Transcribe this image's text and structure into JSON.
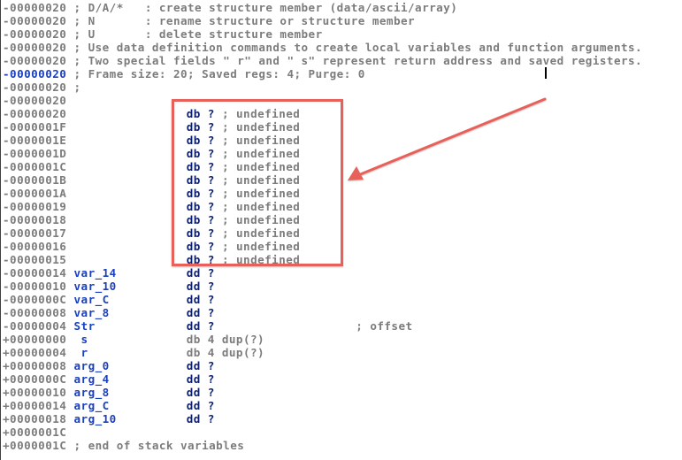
{
  "annotation": {
    "color": "#e8605a"
  },
  "colors": {
    "address": "#7c7c7c",
    "current_address": "#1a3fbf",
    "name": "#1a3fbf",
    "keyword": "#0c1f6e",
    "comment": "#7c7c7c"
  },
  "lines": [
    {
      "addr": "-00000020",
      "name": "",
      "text": "; D/A/*   : create structure member (data/ascii/array)",
      "kind": "comment"
    },
    {
      "addr": "-00000020",
      "name": "",
      "text": "; N       : rename structure or structure member",
      "kind": "comment"
    },
    {
      "addr": "-00000020",
      "name": "",
      "text": "; U       : delete structure member",
      "kind": "comment"
    },
    {
      "addr": "-00000020",
      "name": "",
      "text": "; Use data definition commands to create local variables and function arguments.",
      "kind": "comment"
    },
    {
      "addr": "-00000020",
      "name": "",
      "text": "; Two special fields \" r\" and \" s\" represent return address and saved registers.",
      "kind": "comment"
    },
    {
      "addr": "-00000020",
      "name": "",
      "text": "; Frame size: 20; Saved regs: 4; Purge: 0",
      "kind": "comment",
      "current": true
    },
    {
      "addr": "-00000020",
      "name": "",
      "text": ";",
      "kind": "comment"
    },
    {
      "addr": "-00000020",
      "name": "",
      "text": "",
      "kind": "blank"
    },
    {
      "addr": "-00000020",
      "name": "",
      "kw": "db ?",
      "comment": "; undefined",
      "kind": "undef"
    },
    {
      "addr": "-0000001F",
      "name": "",
      "kw": "db ?",
      "comment": "; undefined",
      "kind": "undef"
    },
    {
      "addr": "-0000001E",
      "name": "",
      "kw": "db ?",
      "comment": "; undefined",
      "kind": "undef"
    },
    {
      "addr": "-0000001D",
      "name": "",
      "kw": "db ?",
      "comment": "; undefined",
      "kind": "undef"
    },
    {
      "addr": "-0000001C",
      "name": "",
      "kw": "db ?",
      "comment": "; undefined",
      "kind": "undef"
    },
    {
      "addr": "-0000001B",
      "name": "",
      "kw": "db ?",
      "comment": "; undefined",
      "kind": "undef"
    },
    {
      "addr": "-0000001A",
      "name": "",
      "kw": "db ?",
      "comment": "; undefined",
      "kind": "undef"
    },
    {
      "addr": "-00000019",
      "name": "",
      "kw": "db ?",
      "comment": "; undefined",
      "kind": "undef"
    },
    {
      "addr": "-00000018",
      "name": "",
      "kw": "db ?",
      "comment": "; undefined",
      "kind": "undef"
    },
    {
      "addr": "-00000017",
      "name": "",
      "kw": "db ?",
      "comment": "; undefined",
      "kind": "undef"
    },
    {
      "addr": "-00000016",
      "name": "",
      "kw": "db ?",
      "comment": "; undefined",
      "kind": "undef"
    },
    {
      "addr": "-00000015",
      "name": "",
      "kw": "db ?",
      "comment": "; undefined",
      "kind": "undef"
    },
    {
      "addr": "-00000014",
      "name": "var_14",
      "kw": "dd ?",
      "comment": "",
      "kind": "var"
    },
    {
      "addr": "-00000010",
      "name": "var_10",
      "kw": "dd ?",
      "comment": "",
      "kind": "var"
    },
    {
      "addr": "-0000000C",
      "name": "var_C",
      "kw": "dd ?",
      "comment": "",
      "kind": "var"
    },
    {
      "addr": "-00000008",
      "name": "var_8",
      "kw": "dd ?",
      "comment": "",
      "kind": "var"
    },
    {
      "addr": "-00000004",
      "name": "Str",
      "kw": "dd ?",
      "comment": "; offset",
      "kind": "var"
    },
    {
      "addr": "+00000000",
      "name": " s",
      "kw": "db 4 dup(?)",
      "comment": "",
      "kind": "special"
    },
    {
      "addr": "+00000004",
      "name": " r",
      "kw": "db 4 dup(?)",
      "comment": "",
      "kind": "special"
    },
    {
      "addr": "+00000008",
      "name": "arg_0",
      "kw": "dd ?",
      "comment": "",
      "kind": "var"
    },
    {
      "addr": "+0000000C",
      "name": "arg_4",
      "kw": "dd ?",
      "comment": "",
      "kind": "var"
    },
    {
      "addr": "+00000010",
      "name": "arg_8",
      "kw": "dd ?",
      "comment": "",
      "kind": "var"
    },
    {
      "addr": "+00000014",
      "name": "arg_C",
      "kw": "dd ?",
      "comment": "",
      "kind": "var"
    },
    {
      "addr": "+00000018",
      "name": "arg_10",
      "kw": "dd ?",
      "comment": "",
      "kind": "var"
    },
    {
      "addr": "+0000001C",
      "name": "",
      "text": "",
      "kind": "blank"
    },
    {
      "addr": "+0000001C",
      "name": "",
      "text": "; end of stack variables",
      "kind": "comment"
    }
  ]
}
